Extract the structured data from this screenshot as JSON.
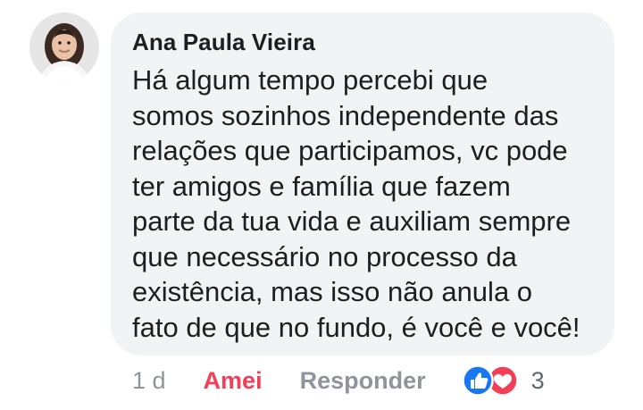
{
  "comment": {
    "author": "Ana Paula Vieira",
    "text": "Há algum tempo percebi que\nsomos sozinhos independente das\nrelações que participamos, vc pode\nter amigos e família que fazem\nparte da tua vida e auxiliam sempre\nque necessário no processo da\nexistência, mas isso não anula o\nfato de que no fundo, é você e você!"
  },
  "actions": {
    "time": "1 d",
    "reaction_label": "Amei",
    "reply_label": "Responder",
    "reaction_count": "3"
  },
  "colors": {
    "bubble": "#f2f3f5",
    "love": "#f33e58",
    "like": "#1877f2",
    "muted": "#90949c"
  }
}
